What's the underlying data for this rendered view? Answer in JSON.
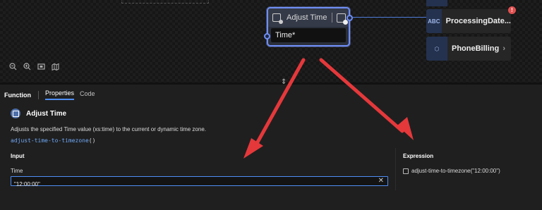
{
  "canvas": {
    "node": {
      "title": "Adjust Time",
      "input_label": "Time*"
    },
    "entities": [
      {
        "icon_text": "ABC",
        "label": "ProcessingDate...",
        "badge": "!"
      },
      {
        "icon_text": "⬡",
        "label": "PhoneBilling",
        "chevron": "›"
      }
    ],
    "zoom_icons": [
      "zoom-out-icon",
      "zoom-in-icon",
      "fit-view-icon",
      "map-icon"
    ],
    "splitter_glyph": "⇕"
  },
  "panel": {
    "tabs": {
      "function_label": "Function",
      "properties": "Properties",
      "code": "Code",
      "active": "Properties"
    },
    "function": {
      "title": "Adjust Time",
      "description": "Adjusts the specified Time value (xs:time) to the current or dynamic time zone.",
      "signature_name": "adjust-time-to-timezone",
      "signature_parens": "()"
    },
    "input": {
      "heading": "Input",
      "time_label": "Time",
      "time_value": "\"12:00:00\"",
      "clear_icon": "✕"
    },
    "expression": {
      "heading": "Expression",
      "value": "adjust-time-to-timezone(\"12:00:00\")"
    }
  },
  "colors": {
    "accent": "#4f8ef5",
    "node_border": "#6e8ef5",
    "arrow": "#e5383b",
    "error": "#e05050"
  }
}
